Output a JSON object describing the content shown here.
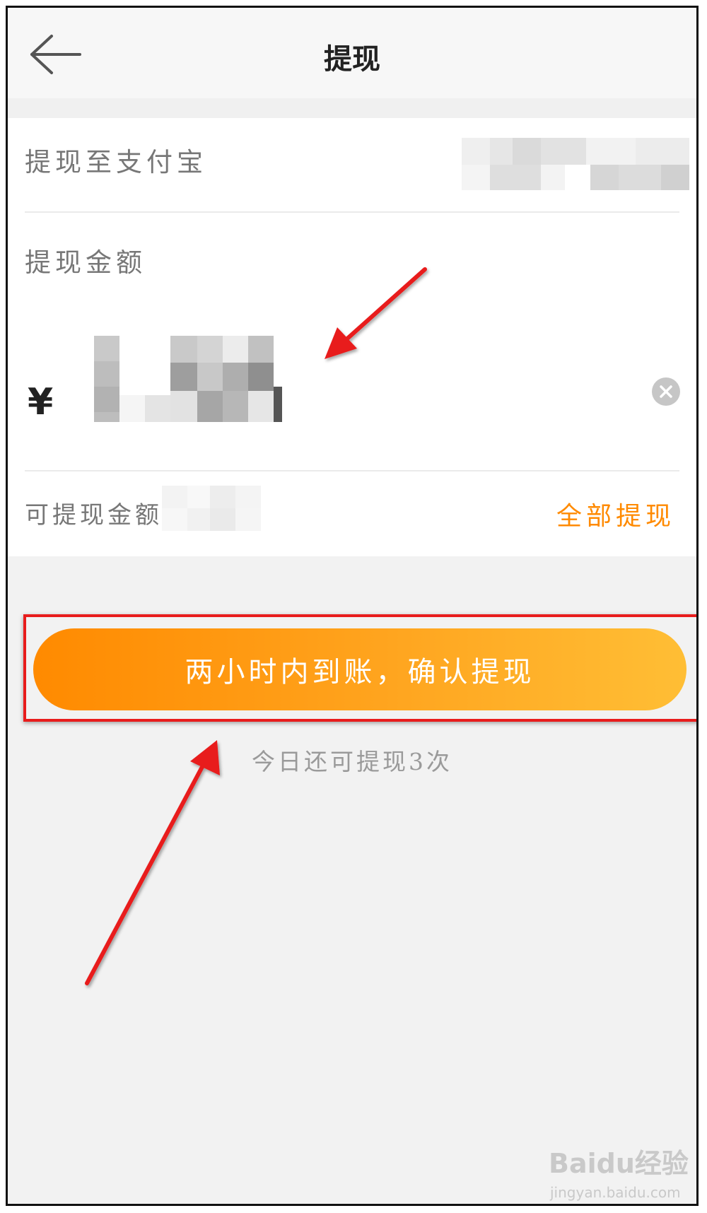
{
  "header": {
    "title": "提现",
    "back_icon": "arrow-left-icon"
  },
  "form": {
    "alipay_label": "提现至支付宝",
    "amount_label": "提现金额",
    "currency_symbol": "¥",
    "amount_value": "",
    "available_label": "可提现金额",
    "withdraw_all_label": "全部提现",
    "clear_icon": "clear-icon"
  },
  "actions": {
    "confirm_label": "两小时内到账，确认提现",
    "remaining_note": "今日还可提现3次"
  },
  "watermark": {
    "brand": "Baidu经验",
    "sub": "jingyan.baidu.com"
  },
  "colors": {
    "accent": "#ff8a00",
    "gradient_end": "#ffbe35",
    "annotation_red": "#e81c1c"
  }
}
